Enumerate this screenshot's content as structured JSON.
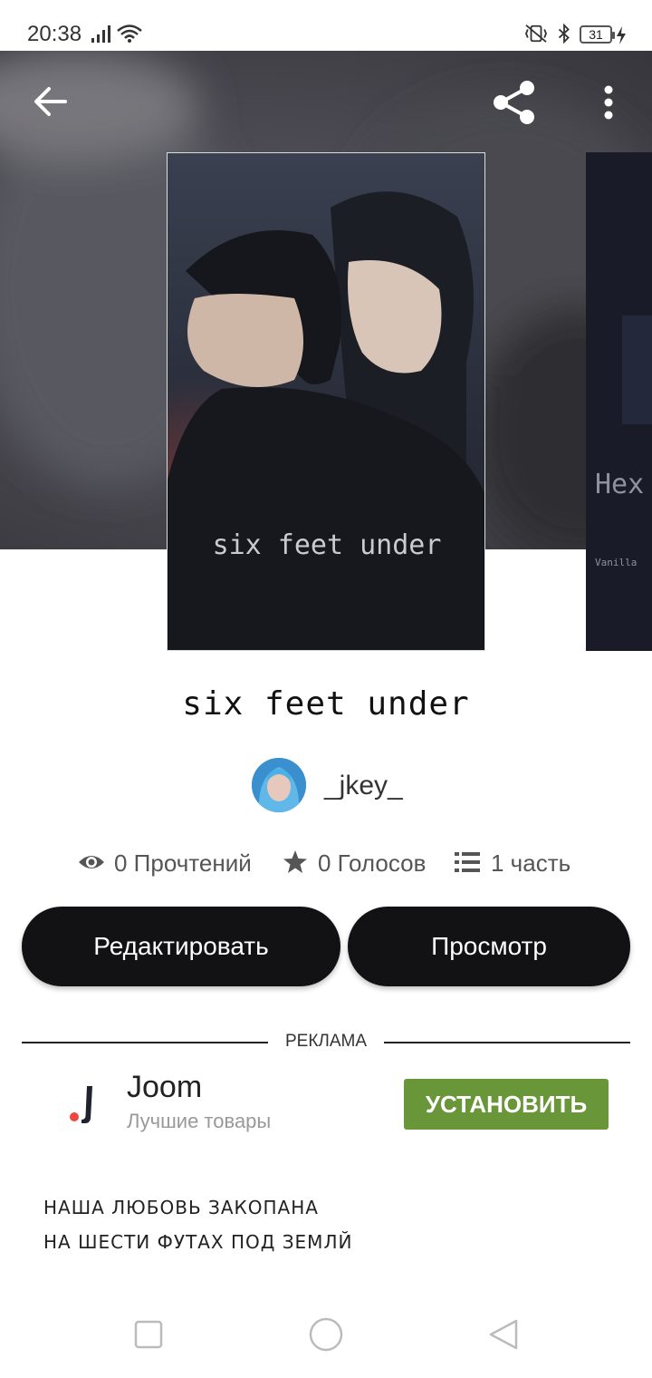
{
  "status_bar": {
    "time": "20:38",
    "battery": "31"
  },
  "header": {
    "back_icon": "arrow-left-icon",
    "share_icon": "share-icon",
    "more_icon": "more-vertical-icon"
  },
  "cover": {
    "title_text": "six feet under",
    "next_cover_text": "Hex",
    "next_cover_subtext": "Vanilla"
  },
  "story": {
    "title": "six feet under",
    "author": "_jkey_",
    "stats": {
      "reads": "0 Прочтений",
      "votes": "0 Голосов",
      "parts": "1 часть"
    }
  },
  "actions": {
    "edit_label": "Редактировать",
    "view_label": "Просмотр"
  },
  "ad": {
    "label": "РЕКЛАМА",
    "title": "Joom",
    "subtitle": "Лучшие товары",
    "install_label": "УСТАНОВИТЬ"
  },
  "description": {
    "line1": "НАША ЛЮБОВЬ ЗАКОПАНА",
    "line2": "НА ШЕСТИ ФУТАХ ПОД ЗЕМЛЙ"
  },
  "colors": {
    "button_bg": "#121214",
    "install_bg": "#6a963a"
  }
}
